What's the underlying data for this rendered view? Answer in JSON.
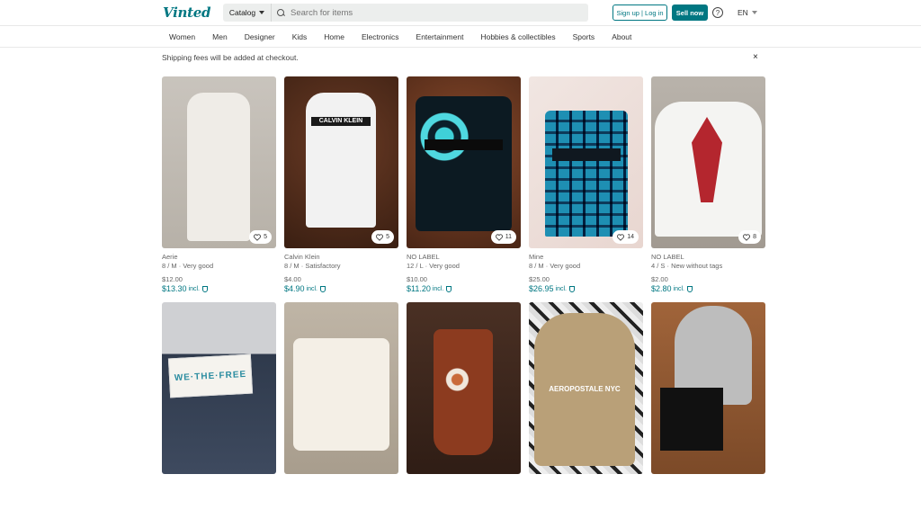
{
  "header": {
    "logo": "Vinted",
    "catalog_label": "Catalog",
    "search_placeholder": "Search for items",
    "signup_label": "Sign up | Log in",
    "sell_label": "Sell now",
    "help_label": "?",
    "lang_label": "EN"
  },
  "nav": [
    "Women",
    "Men",
    "Designer",
    "Kids",
    "Home",
    "Electronics",
    "Entertainment",
    "Hobbies & collectibles",
    "Sports",
    "About"
  ],
  "banner": {
    "text": "Shipping fees will be added at checkout.",
    "close": "×"
  },
  "items": [
    {
      "brand": "Aerie",
      "condition": "8 / M · Very good",
      "price": "$12.00",
      "incl_price": "$13.30",
      "incl_label": "incl.",
      "favorites": "5"
    },
    {
      "brand": "Calvin Klein",
      "condition": "8 / M · Satisfactory",
      "price": "$4.00",
      "incl_price": "$4.90",
      "incl_label": "incl.",
      "favorites": "5"
    },
    {
      "brand": "NO LABEL",
      "condition": "12 / L · Very good",
      "price": "$10.00",
      "incl_price": "$11.20",
      "incl_label": "incl.",
      "favorites": "11"
    },
    {
      "brand": "Mine",
      "condition": "8 / M · Very good",
      "price": "$25.00",
      "incl_price": "$26.95",
      "incl_label": "incl.",
      "favorites": "14"
    },
    {
      "brand": "NO LABEL",
      "condition": "4 / S · New without tags",
      "price": "$2.00",
      "incl_price": "$2.80",
      "incl_label": "incl.",
      "favorites": "8"
    }
  ],
  "image_text": {
    "calvin_klein": "CALVIN KLEIN",
    "we_the_free": "WE·THE·FREE",
    "aeropostale": "AEROPOSTALE NYC"
  }
}
